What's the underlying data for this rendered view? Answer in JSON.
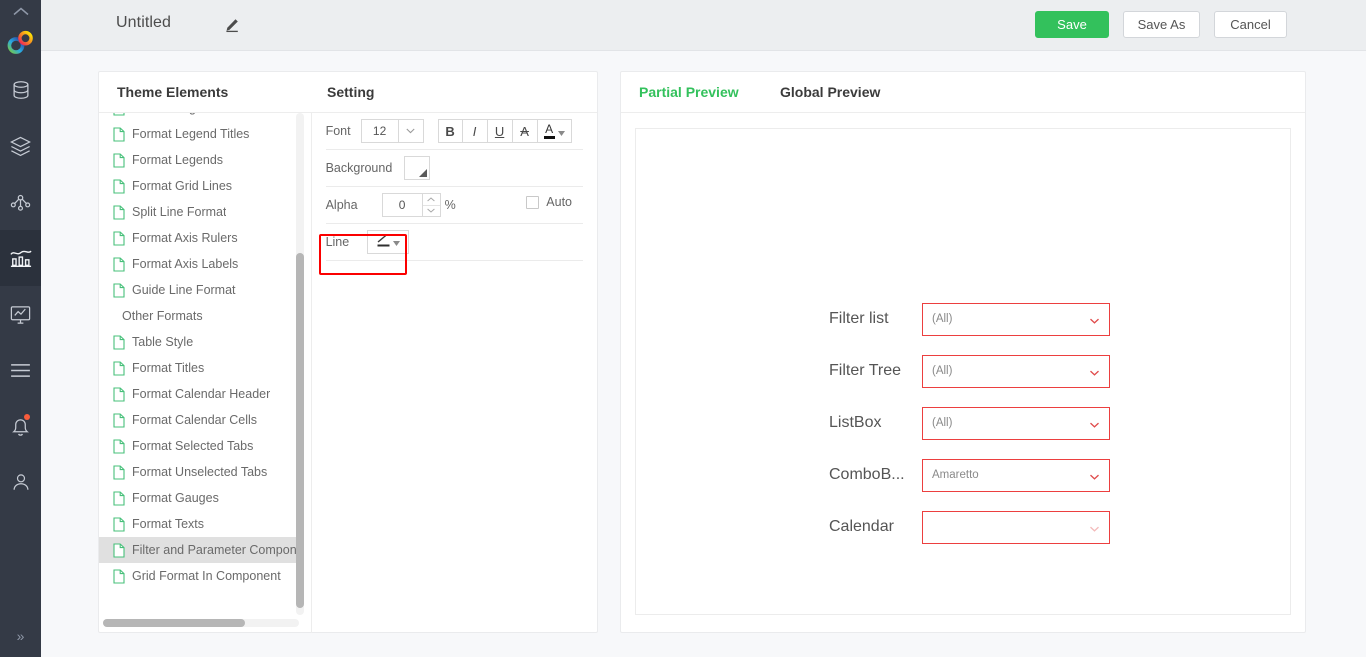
{
  "rail": {
    "collapse_top_icon": "chevron-up-icon",
    "logo_icon": "brand-rings-logo",
    "items": [
      {
        "icon": "database-icon",
        "name": "sidebar-item-data",
        "active": false,
        "badge": false
      },
      {
        "icon": "layers-icon",
        "name": "sidebar-item-datasets",
        "active": false,
        "badge": false
      },
      {
        "icon": "network-icon",
        "name": "sidebar-item-relations",
        "active": false,
        "badge": false
      },
      {
        "icon": "bar-chart-icon",
        "name": "sidebar-item-analysis",
        "active": true,
        "badge": false
      },
      {
        "icon": "monitor-chart-icon",
        "name": "sidebar-item-dashboard",
        "active": false,
        "badge": false
      },
      {
        "icon": "menu-lines-icon",
        "name": "sidebar-item-list",
        "active": false,
        "badge": false
      },
      {
        "icon": "bell-icon",
        "name": "sidebar-item-notifications",
        "active": false,
        "badge": true
      },
      {
        "icon": "user-icon",
        "name": "sidebar-item-account",
        "active": false,
        "badge": false
      }
    ],
    "expand_icon": "chevron-double-right-icon"
  },
  "header": {
    "title": "Untitled",
    "edit_icon": "pencil-icon",
    "save_label": "Save",
    "save_as_label": "Save As",
    "cancel_label": "Cancel",
    "save_color": "#33c15c"
  },
  "theme_panel": {
    "heading": "Theme Elements",
    "items": [
      {
        "label": "Format Legend Colors",
        "group": false,
        "selected": false
      },
      {
        "label": "Format Legend Titles",
        "group": false,
        "selected": false
      },
      {
        "label": "Format Legends",
        "group": false,
        "selected": false
      },
      {
        "label": "Format Grid Lines",
        "group": false,
        "selected": false
      },
      {
        "label": "Split Line Format",
        "group": false,
        "selected": false
      },
      {
        "label": "Format Axis Rulers",
        "group": false,
        "selected": false
      },
      {
        "label": "Format Axis Labels",
        "group": false,
        "selected": false
      },
      {
        "label": "Guide Line Format",
        "group": false,
        "selected": false
      },
      {
        "label": "Other Formats",
        "group": true,
        "selected": false
      },
      {
        "label": "Table Style",
        "group": false,
        "selected": false
      },
      {
        "label": "Format Titles",
        "group": false,
        "selected": false
      },
      {
        "label": "Format Calendar Header",
        "group": false,
        "selected": false
      },
      {
        "label": "Format Calendar Cells",
        "group": false,
        "selected": false
      },
      {
        "label": "Format Selected Tabs",
        "group": false,
        "selected": false
      },
      {
        "label": "Format Unselected Tabs",
        "group": false,
        "selected": false
      },
      {
        "label": "Format Gauges",
        "group": false,
        "selected": false
      },
      {
        "label": "Format Texts",
        "group": false,
        "selected": false
      },
      {
        "label": "Filter and Parameter Componen",
        "group": false,
        "selected": true
      },
      {
        "label": "Grid Format In Component",
        "group": false,
        "selected": false
      }
    ]
  },
  "setting_panel": {
    "heading": "Setting",
    "font": {
      "label": "Font",
      "size_value": "12",
      "dropdown_icon": "chevron-down-icon",
      "bold_label": "B",
      "italic_label": "I",
      "underline_label": "U",
      "strikethrough_label": "A",
      "text_color_label": "A",
      "text_color_swatch": "#111111"
    },
    "background": {
      "label": "Background",
      "swatch_icon": "color-picker-icon"
    },
    "alpha": {
      "label": "Alpha",
      "value": "0",
      "unit": "%",
      "auto_label": "Auto",
      "auto_checked": false
    },
    "line": {
      "label": "Line",
      "button_icon": "line-style-icon",
      "dropdown_icon": "caret-down-icon",
      "highlight_color": "#fb0000"
    }
  },
  "preview_panel": {
    "tabs": [
      {
        "label": "Partial Preview",
        "active": true
      },
      {
        "label": "Global Preview",
        "active": false
      }
    ],
    "active_tab_color": "#33c15c",
    "field_border_color": "#ec3f3f",
    "fields": [
      {
        "label": "Filter list",
        "value": "(All)",
        "caret_icon": "chevron-down-icon",
        "caret_faded": false
      },
      {
        "label": "Filter Tree",
        "value": "(All)",
        "caret_icon": "chevron-down-icon",
        "caret_faded": false
      },
      {
        "label": "ListBox",
        "value": "(All)",
        "caret_icon": "chevron-down-icon",
        "caret_faded": false
      },
      {
        "label": "ComboB...",
        "value": "Amaretto",
        "caret_icon": "chevron-down-icon",
        "caret_faded": false
      },
      {
        "label": "Calendar",
        "value": "",
        "caret_icon": "chevron-down-icon",
        "caret_faded": true
      }
    ]
  }
}
